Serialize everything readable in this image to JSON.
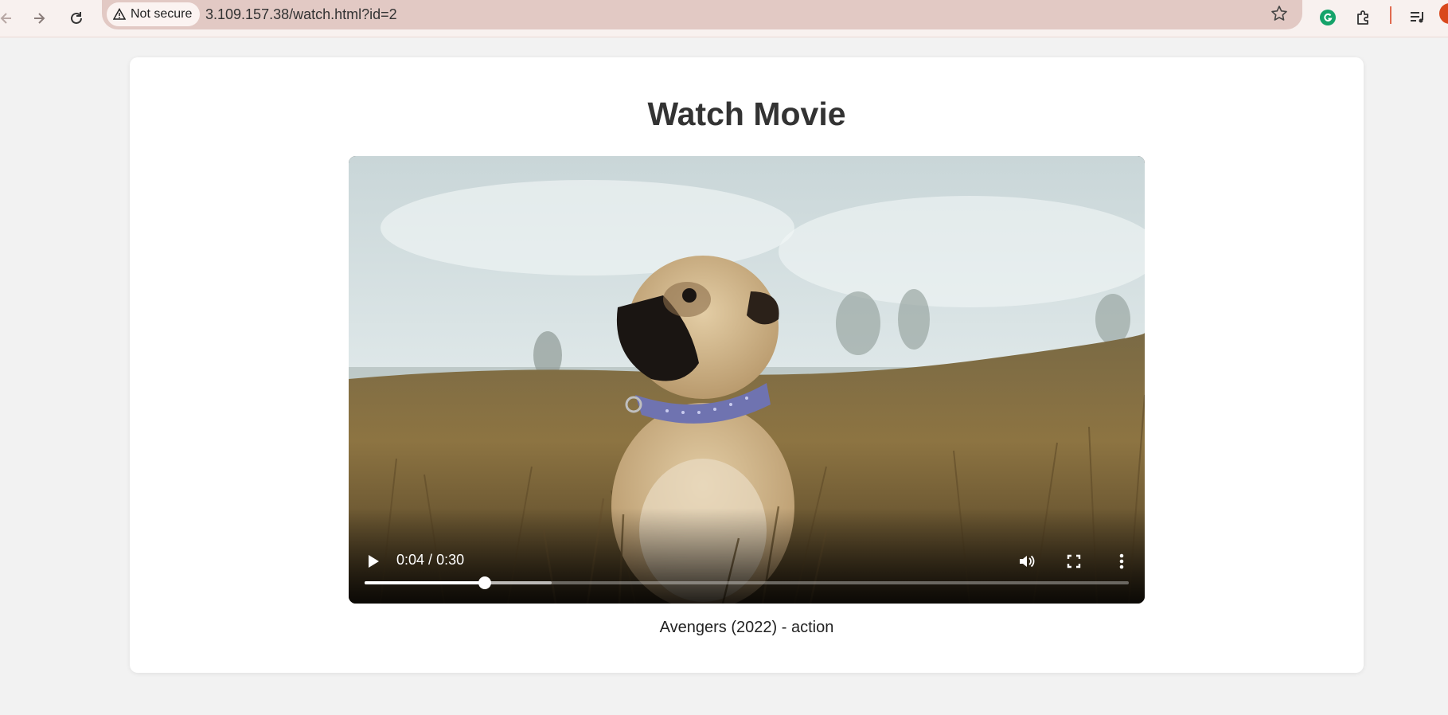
{
  "browser": {
    "security_label": "Not secure",
    "url": "3.109.157.38/watch.html?id=2",
    "icons": [
      "back-arrow-icon",
      "forward-arrow-icon",
      "reload-icon",
      "warning-icon",
      "star-icon",
      "grammarly-icon",
      "extensions-icon",
      "media-queue-icon"
    ]
  },
  "page": {
    "title": "Watch Movie",
    "caption": "Avengers (2022) - action"
  },
  "video": {
    "current_time": "0:04",
    "separator": " / ",
    "duration": "0:30",
    "played_fraction": 0.157,
    "buffered_fraction": 0.245,
    "poster_subject": "pug sitting in tall grass"
  },
  "colors": {
    "page_bg": "#f2f2f2",
    "omnibox": "#e2c9c4",
    "title_text": "#333333"
  }
}
